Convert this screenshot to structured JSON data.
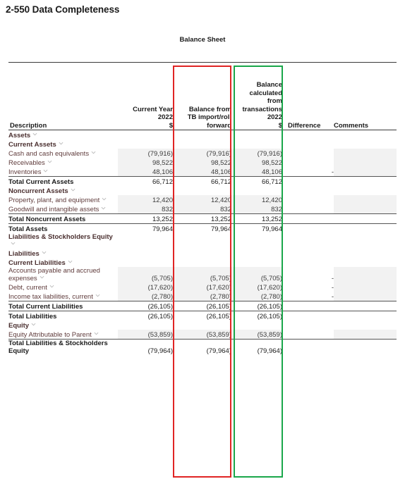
{
  "page": {
    "title": "2-550 Data Completeness",
    "sheet_title": "Balance Sheet"
  },
  "annotations": {
    "red_box": {
      "color": "#e02424",
      "targets_column": "Balance from TB import/roll forward"
    },
    "green_box": {
      "color": "#1aa74a",
      "targets_column": "Balance calculated from transactions 2022 $"
    }
  },
  "table": {
    "columns": [
      {
        "key": "description",
        "label": "Description",
        "align": "left"
      },
      {
        "key": "current_year",
        "label": "Current Year\n2022\n$",
        "label_lines": [
          "Current Year",
          "2022",
          "$"
        ],
        "align": "right"
      },
      {
        "key": "tb_import",
        "label": "Balance from TB import/roll forward",
        "label_lines": [
          "Balance from",
          "TB import/roll",
          "forward"
        ],
        "align": "right"
      },
      {
        "key": "calculated",
        "label": "Balance calculated from transactions 2022 $",
        "label_lines": [
          "Balance",
          "calculated",
          "from",
          "transactions",
          "2022",
          "$"
        ],
        "align": "right"
      },
      {
        "key": "difference",
        "label": "Difference",
        "align": "left"
      },
      {
        "key": "comments",
        "label": "Comments",
        "align": "left"
      }
    ],
    "rows": [
      {
        "description": "Assets",
        "level": 0,
        "style": "group",
        "chevron": true,
        "current_year": "",
        "tb_import": "",
        "calculated": "",
        "difference": "",
        "comments": "",
        "shaded": false,
        "rule_top": false,
        "rule_bottom": false
      },
      {
        "description": "Current Assets",
        "level": 1,
        "style": "group",
        "chevron": true,
        "current_year": "",
        "tb_import": "",
        "calculated": "",
        "difference": "",
        "comments": "",
        "shaded": false,
        "rule_top": false,
        "rule_bottom": false
      },
      {
        "description": "Cash and cash equivalents",
        "level": 2,
        "style": "detail",
        "chevron": true,
        "wrap": true,
        "current_year": "(79,916)",
        "tb_import": "(79,916)",
        "calculated": "(79,916)",
        "difference": "",
        "comments": "",
        "shaded": true,
        "rule_top": false,
        "rule_bottom": false
      },
      {
        "description": "Receivables",
        "level": 2,
        "style": "detail",
        "chevron": true,
        "current_year": "98,522",
        "tb_import": "98,522",
        "calculated": "98,522",
        "difference": "",
        "comments": "",
        "shaded": true,
        "rule_top": false,
        "rule_bottom": false
      },
      {
        "description": "Inventories",
        "level": 2,
        "style": "detail",
        "chevron": true,
        "current_year": "48,106",
        "tb_import": "48,106",
        "calculated": "48,106",
        "difference": "-",
        "comments": "",
        "shaded": true,
        "rule_top": false,
        "rule_bottom": true
      },
      {
        "description": "Total Current Assets",
        "level": 1,
        "style": "total",
        "chevron": false,
        "current_year": "66,712",
        "tb_import": "66,712",
        "calculated": "66,712",
        "difference": "",
        "comments": "",
        "shaded": false,
        "rule_top": false,
        "rule_bottom": false
      },
      {
        "description": "Noncurrent Assets",
        "level": 1,
        "style": "group",
        "chevron": true,
        "current_year": "",
        "tb_import": "",
        "calculated": "",
        "difference": "",
        "comments": "",
        "shaded": false,
        "rule_top": false,
        "rule_bottom": false
      },
      {
        "description": "Property, plant, and equipment",
        "level": 2,
        "style": "detail",
        "chevron": true,
        "wrap": true,
        "current_year": "12,420",
        "tb_import": "12,420",
        "calculated": "12,420",
        "difference": "",
        "comments": "",
        "shaded": true,
        "rule_top": false,
        "rule_bottom": false
      },
      {
        "description": "Goodwill and intangible assets",
        "level": 2,
        "style": "detail",
        "chevron": true,
        "wrap": true,
        "current_year": "832",
        "tb_import": "832",
        "calculated": "832",
        "difference": "",
        "comments": "",
        "shaded": true,
        "rule_top": false,
        "rule_bottom": true
      },
      {
        "description": "Total Noncurrent Assets",
        "level": 1,
        "style": "total",
        "chevron": false,
        "current_year": "13,252",
        "tb_import": "13,252",
        "calculated": "13,252",
        "difference": "",
        "comments": "",
        "shaded": false,
        "rule_top": false,
        "rule_bottom": true
      },
      {
        "description": "Total Assets",
        "level": 0,
        "style": "total",
        "chevron": false,
        "current_year": "79,964",
        "tb_import": "79,964",
        "calculated": "79,964",
        "difference": "",
        "comments": "",
        "shaded": false,
        "rule_top": false,
        "rule_bottom": false
      },
      {
        "description": "Liabilities & Stockholders Equity",
        "level": 0,
        "style": "group",
        "chevron": true,
        "wrap": true,
        "current_year": "",
        "tb_import": "",
        "calculated": "",
        "difference": "",
        "comments": "",
        "shaded": false,
        "rule_top": false,
        "rule_bottom": false
      },
      {
        "description": "Liabilities",
        "level": 1,
        "style": "group",
        "chevron": true,
        "current_year": "",
        "tb_import": "",
        "calculated": "",
        "difference": "",
        "comments": "",
        "shaded": false,
        "rule_top": false,
        "rule_bottom": false
      },
      {
        "description": "Current Liabilities",
        "level": 2,
        "style": "group",
        "chevron": true,
        "current_year": "",
        "tb_import": "",
        "calculated": "",
        "difference": "",
        "comments": "",
        "shaded": false,
        "rule_top": false,
        "rule_bottom": false
      },
      {
        "description": "Accounts payable and accrued expenses",
        "level": 3,
        "style": "detail",
        "chevron": true,
        "wrap": true,
        "current_year": "(5,705)",
        "tb_import": "(5,705)",
        "calculated": "(5,705)",
        "difference": "-",
        "comments": "",
        "shaded": true,
        "rule_top": false,
        "rule_bottom": false
      },
      {
        "description": "Debt, current",
        "level": 3,
        "style": "detail",
        "chevron": true,
        "current_year": "(17,620)",
        "tb_import": "(17,620)",
        "calculated": "(17,620)",
        "difference": "-",
        "comments": "",
        "shaded": true,
        "rule_top": false,
        "rule_bottom": false
      },
      {
        "description": "Income tax liabilities, current",
        "level": 3,
        "style": "detail",
        "chevron": true,
        "wrap": true,
        "current_year": "(2,780)",
        "tb_import": "(2,780)",
        "calculated": "(2,780)",
        "difference": "-",
        "comments": "",
        "shaded": true,
        "rule_top": false,
        "rule_bottom": true
      },
      {
        "description": "Total Current Liabilities",
        "level": 2,
        "style": "total",
        "chevron": false,
        "current_year": "(26,105)",
        "tb_import": "(26,105)",
        "calculated": "(26,105)",
        "difference": "",
        "comments": "",
        "shaded": false,
        "rule_top": false,
        "rule_bottom": true
      },
      {
        "description": "Total Liabilities",
        "level": 1,
        "style": "total",
        "chevron": false,
        "current_year": "(26,105)",
        "tb_import": "(26,105)",
        "calculated": "(26,105)",
        "difference": "",
        "comments": "",
        "shaded": false,
        "rule_top": false,
        "rule_bottom": false
      },
      {
        "description": "Equity",
        "level": 1,
        "style": "group",
        "chevron": true,
        "current_year": "",
        "tb_import": "",
        "calculated": "",
        "difference": "",
        "comments": "",
        "shaded": false,
        "rule_top": false,
        "rule_bottom": false
      },
      {
        "description": "Equity Attributable to Parent",
        "level": 2,
        "style": "detail",
        "chevron": true,
        "wrap": true,
        "current_year": "(53,859)",
        "tb_import": "(53,859)",
        "calculated": "(53,859)",
        "difference": "",
        "comments": "",
        "shaded": true,
        "rule_top": false,
        "rule_bottom": true
      },
      {
        "description": "Total Liabilities & Stockholders Equity",
        "level": 0,
        "style": "total",
        "chevron": false,
        "wrap": true,
        "current_year": "(79,964)",
        "tb_import": "(79,964)",
        "calculated": "(79,964)",
        "difference": "",
        "comments": "",
        "shaded": false,
        "rule_top": false,
        "rule_bottom": false
      }
    ]
  }
}
